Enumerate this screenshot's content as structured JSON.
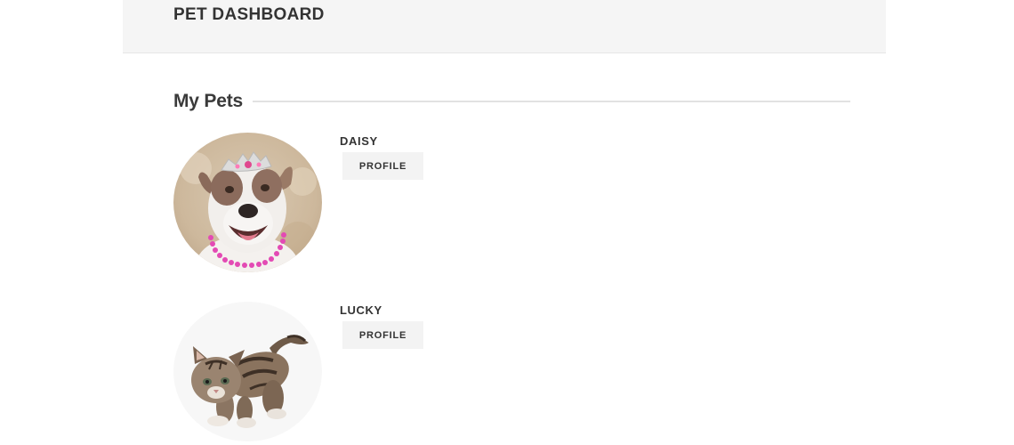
{
  "header": {
    "title": "PET DASHBOARD"
  },
  "section": {
    "title": "My Pets"
  },
  "pets": [
    {
      "name": "DAISY",
      "profile_label": "PROFILE",
      "photo": "dog-with-tiara-and-pink-necklace"
    },
    {
      "name": "LUCKY",
      "profile_label": "PROFILE",
      "photo": "tabby-kitten"
    }
  ],
  "colors": {
    "header_bg": "#f5f5f5",
    "button_bg": "#f3f3f3",
    "text": "#333333",
    "rule": "#e2e2e2"
  }
}
